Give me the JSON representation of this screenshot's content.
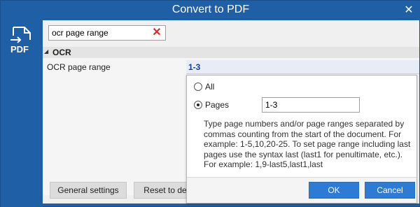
{
  "window": {
    "title": "Convert to PDF",
    "close_icon": "close-icon"
  },
  "sidebar": {
    "logo_icon": "pdf-logo-icon",
    "logo_text": "PDF"
  },
  "search": {
    "value": "ocr page range",
    "clear_icon": "clear-icon"
  },
  "grid": {
    "group": {
      "label": "OCR",
      "toggle_icon": "triangle-collapse-icon"
    },
    "row": {
      "name": "OCR page range",
      "value": "1-3"
    }
  },
  "footer": {
    "general_settings": "General settings",
    "reset_default": "Reset to defa"
  },
  "popup": {
    "option_all": "All",
    "option_pages": "Pages",
    "selected": "Pages",
    "pages_value": "1-3",
    "help": "Type page numbers and/or page ranges separated by commas counting from the start of the document. For example: 1-5,10,20-25. To set page range including last pages use the syntax last (last1 for penultimate, etc.). For example: 1,9-last5,last1,last",
    "ok": "OK",
    "cancel": "Cancel"
  },
  "colors": {
    "accent": "#1f5fa6",
    "button_blue": "#2e7bd6",
    "clear_red": "#d92b2b",
    "value_text": "#1b3f8b"
  }
}
